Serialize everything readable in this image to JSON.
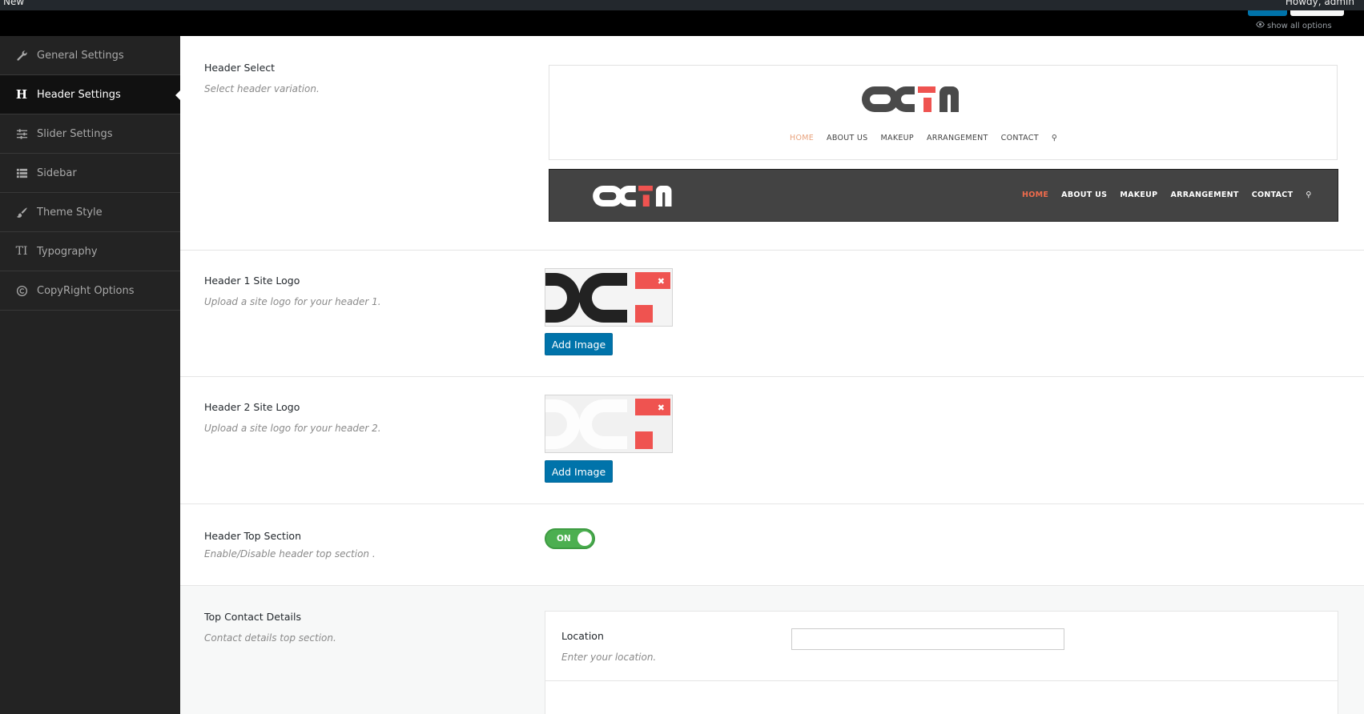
{
  "adminbar": {
    "new_label": "New",
    "howdy": "Howdy, admin",
    "show_all": "show all options"
  },
  "sidebar": {
    "items": [
      {
        "label": "General Settings",
        "icon": "wrench-icon"
      },
      {
        "label": "Header Settings",
        "icon": "header-icon"
      },
      {
        "label": "Slider Settings",
        "icon": "sliders-icon"
      },
      {
        "label": "Sidebar",
        "icon": "list-icon"
      },
      {
        "label": "Theme Style",
        "icon": "brush-icon"
      },
      {
        "label": "Typography",
        "icon": "text-icon"
      },
      {
        "label": "CopyRight Options",
        "icon": "copyright-icon"
      }
    ],
    "active_index": 1
  },
  "sections": {
    "header_select": {
      "title": "Header Select",
      "desc": "Select header variation.",
      "preview_nav": [
        "HOME",
        "ABOUT US",
        "MAKEUP",
        "ARRANGEMENT",
        "CONTACT"
      ]
    },
    "header1_logo": {
      "title": "Header 1 Site Logo",
      "desc": "Upload a site logo for your header 1.",
      "button": "Add Image"
    },
    "header2_logo": {
      "title": "Header 2 Site Logo",
      "desc": "Upload a site logo for your header 2.",
      "button": "Add Image"
    },
    "header_top": {
      "title": "Header Top Section",
      "desc": " Enable/Disable header top section .",
      "toggle_label": "ON",
      "toggle_on": true
    },
    "top_contact": {
      "title": "Top Contact Details",
      "desc": "Contact details top section.",
      "location_title": "Location",
      "location_desc": "Enter your location.",
      "location_value": ""
    }
  },
  "colors": {
    "accent": "#0073aa",
    "toggle_on": "#4caf50",
    "logo_red": "#ef5350",
    "sidebar_bg": "#232323"
  }
}
